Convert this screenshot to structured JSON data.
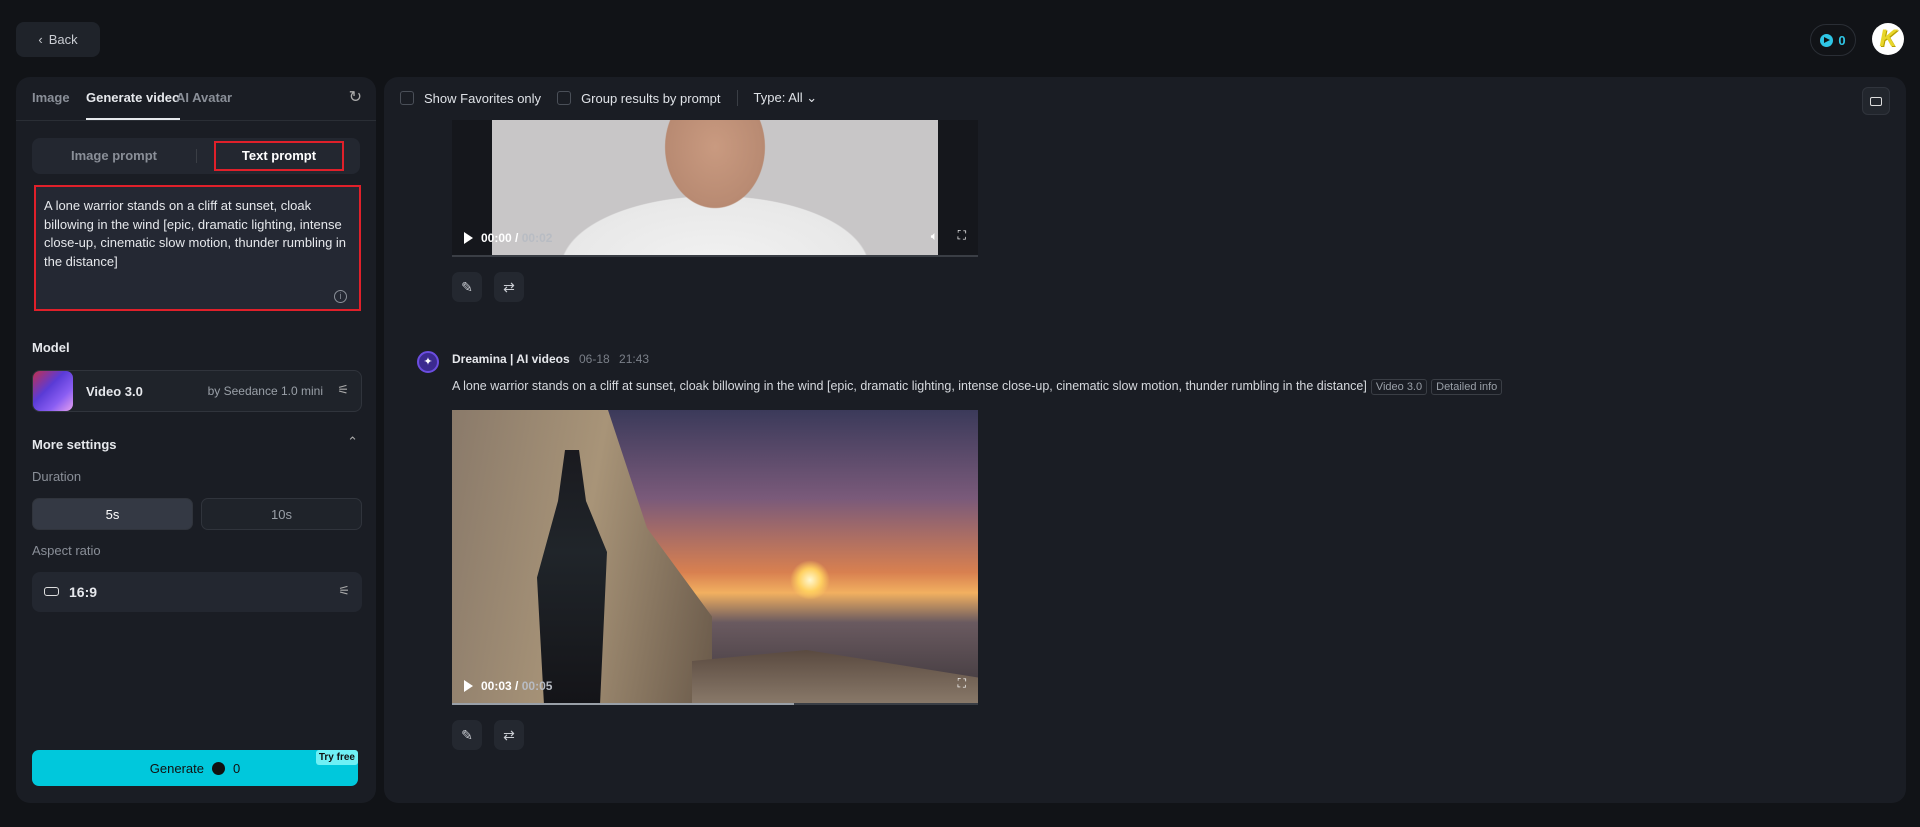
{
  "header": {
    "back_label": "Back",
    "credits": "0",
    "avatar_letter": "K"
  },
  "left": {
    "tabs": [
      {
        "label": "Image"
      },
      {
        "label": "Generate video"
      },
      {
        "label": "AI Avatar"
      }
    ],
    "prompt_modes": {
      "image": "Image prompt",
      "text": "Text prompt"
    },
    "prompt_text": "A lone warrior stands on a cliff at sunset, cloak billowing in the wind [epic, dramatic lighting, intense close-up, cinematic slow motion, thunder rumbling in the distance]",
    "model_label": "Model",
    "model": {
      "name": "Video 3.0",
      "provider": "by Seedance 1.0 mini"
    },
    "more_settings": "More settings",
    "duration_label": "Duration",
    "durations": [
      {
        "label": "5s",
        "selected": true
      },
      {
        "label": "10s",
        "selected": false
      }
    ],
    "aspect_label": "Aspect ratio",
    "aspect_value": "16:9",
    "generate": {
      "label": "Generate",
      "cost": "0",
      "badge": "Try free"
    }
  },
  "main": {
    "toolbar": {
      "favorites": "Show Favorites only",
      "group": "Group results by prompt",
      "type": "Type: All"
    },
    "items": [
      {
        "time": "00:00",
        "duration": "00:02",
        "progress": 0
      },
      {
        "author": "Dreamina | AI videos",
        "date": "06-18",
        "time_of_day": "21:43",
        "prompt": "A lone warrior stands on a cliff at sunset, cloak billowing in the wind [epic, dramatic lighting, intense close-up, cinematic slow motion, thunder rumbling in the distance]",
        "tags": [
          "Video 3.0",
          "Detailed info"
        ],
        "time": "00:03",
        "duration": "00:05",
        "progress": 0.65
      }
    ]
  }
}
